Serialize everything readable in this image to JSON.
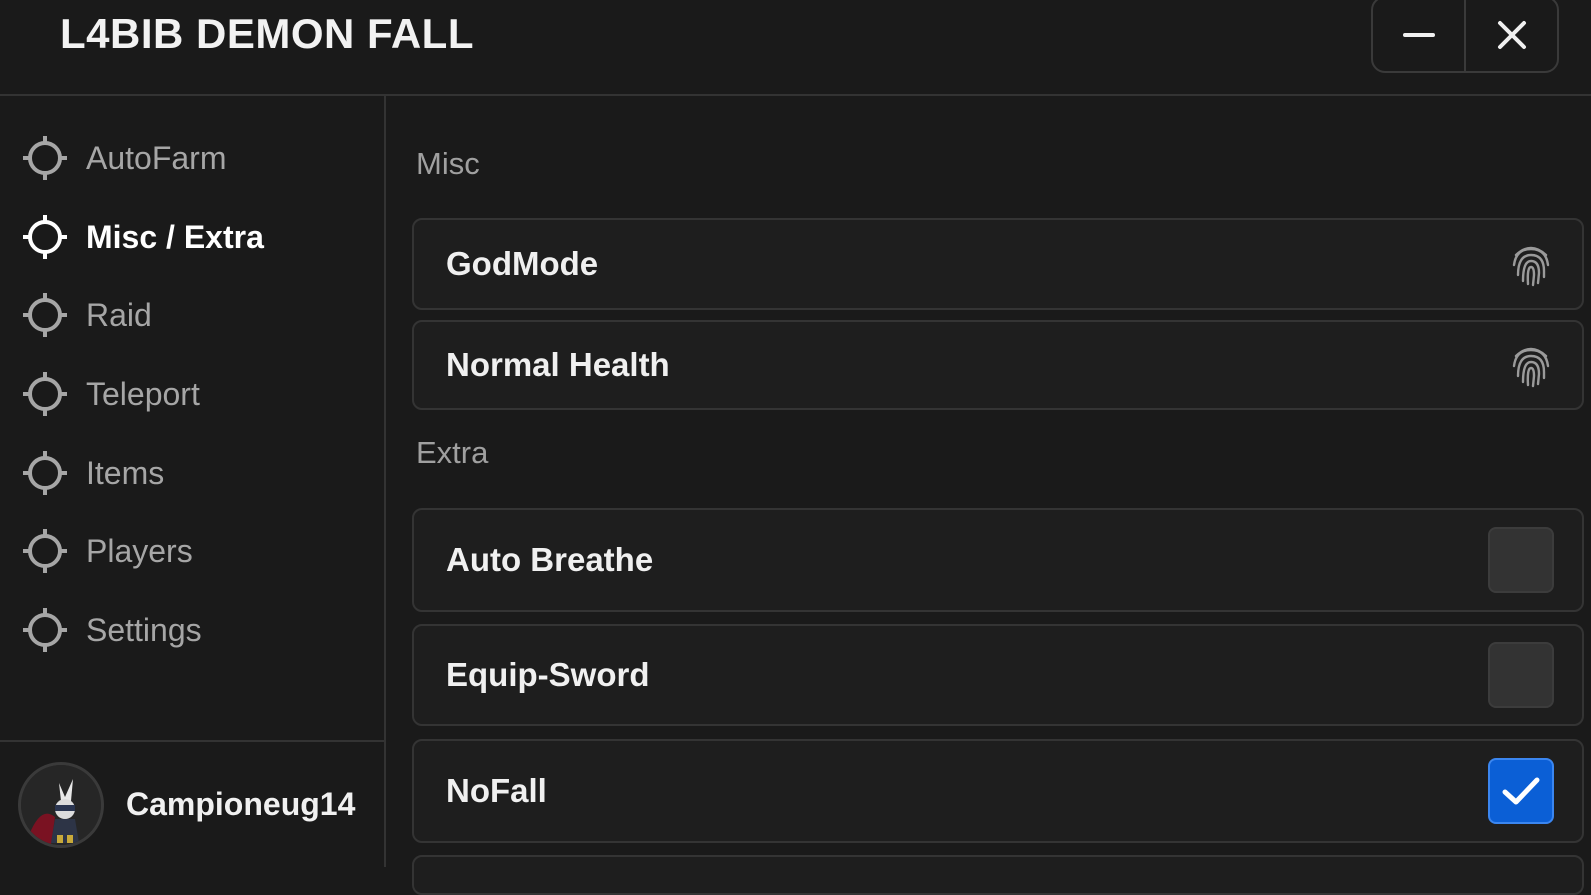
{
  "window": {
    "title": "L4BIB DEMON FALL",
    "minimize_icon": "minimize-icon",
    "close_icon": "close-icon"
  },
  "sidebar": {
    "items": [
      {
        "label": "AutoFarm",
        "icon": "crosshair-icon",
        "active": false
      },
      {
        "label": "Misc / Extra",
        "icon": "crosshair-icon",
        "active": true
      },
      {
        "label": "Raid",
        "icon": "crosshair-icon",
        "active": false
      },
      {
        "label": "Teleport",
        "icon": "crosshair-icon",
        "active": false
      },
      {
        "label": "Items",
        "icon": "crosshair-icon",
        "active": false
      },
      {
        "label": "Players",
        "icon": "crosshair-icon",
        "active": false
      },
      {
        "label": "Settings",
        "icon": "crosshair-icon",
        "active": false
      }
    ]
  },
  "profile": {
    "username": "Campioneug14",
    "avatar_icon": "avatar"
  },
  "main": {
    "sections": [
      {
        "title": "Misc",
        "rows": [
          {
            "label": "GodMode",
            "control": "button",
            "icon": "fingerprint-icon"
          },
          {
            "label": "Normal Health",
            "control": "button",
            "icon": "fingerprint-icon"
          }
        ]
      },
      {
        "title": "Extra",
        "rows": [
          {
            "label": "Auto Breathe",
            "control": "checkbox",
            "checked": false
          },
          {
            "label": "Equip-Sword",
            "control": "checkbox",
            "checked": false
          },
          {
            "label": "NoFall",
            "control": "checkbox",
            "checked": true
          }
        ]
      }
    ]
  },
  "colors": {
    "background": "#1a1a1a",
    "accent": "#0b5fd6",
    "text_primary": "#f0f0f0",
    "text_muted": "#a6a6a6"
  }
}
